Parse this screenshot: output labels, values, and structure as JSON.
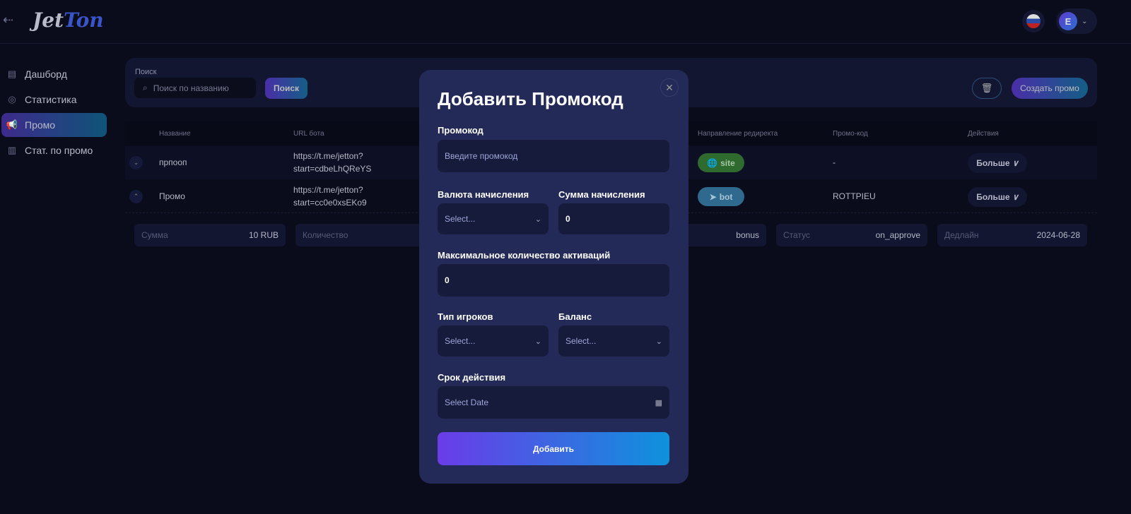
{
  "header": {
    "logo": "JetTon",
    "avatar_letter": "E"
  },
  "sidebar": {
    "items": [
      {
        "label": "Дашборд",
        "icon": "dashboard-icon"
      },
      {
        "label": "Статистика",
        "icon": "stats-icon"
      },
      {
        "label": "Промо",
        "icon": "megaphone-icon",
        "active": true
      },
      {
        "label": "Стат. по промо",
        "icon": "chart-icon"
      }
    ]
  },
  "search": {
    "label": "Поиск",
    "placeholder": "Поиск по названию",
    "button": "Поиск",
    "create": "Создать промо"
  },
  "table": {
    "columns": [
      "Название",
      "URL бота",
      "Направление редиректа",
      "Промо-код",
      "Действия"
    ],
    "rows": [
      {
        "name": "прпооп",
        "url1": "https://t.me/jetton?",
        "url2": "start=cdbeLhQReYS",
        "redirect": "site",
        "code": "-",
        "action": "Больше"
      },
      {
        "name": "Промо",
        "url1": "https://t.me/jetton?",
        "url2": "start=cc0e0xsEKo9",
        "redirect": "bot",
        "code": "ROTTPIEU",
        "action": "Больше"
      }
    ],
    "details": {
      "sum_label": "Сумма",
      "sum": "10 RUB",
      "count_label": "Количество",
      "type": "bonus",
      "status_label": "Статус",
      "status": "on_approve",
      "deadline_label": "Дедлайн",
      "deadline": "2024-06-28"
    }
  },
  "modal": {
    "title": "Добавить Промокод",
    "promo_label": "Промокод",
    "promo_placeholder": "Введите промокод",
    "currency_label": "Валюта начисления",
    "currency_value": "Select...",
    "amount_label": "Сумма начисления",
    "amount_value": "0",
    "max_label": "Максимальное количество активаций",
    "max_value": "0",
    "players_label": "Тип игроков",
    "players_value": "Select...",
    "balance_label": "Баланс",
    "balance_value": "Select...",
    "date_label": "Срок действия",
    "date_placeholder": "Select Date",
    "submit": "Добавить"
  }
}
